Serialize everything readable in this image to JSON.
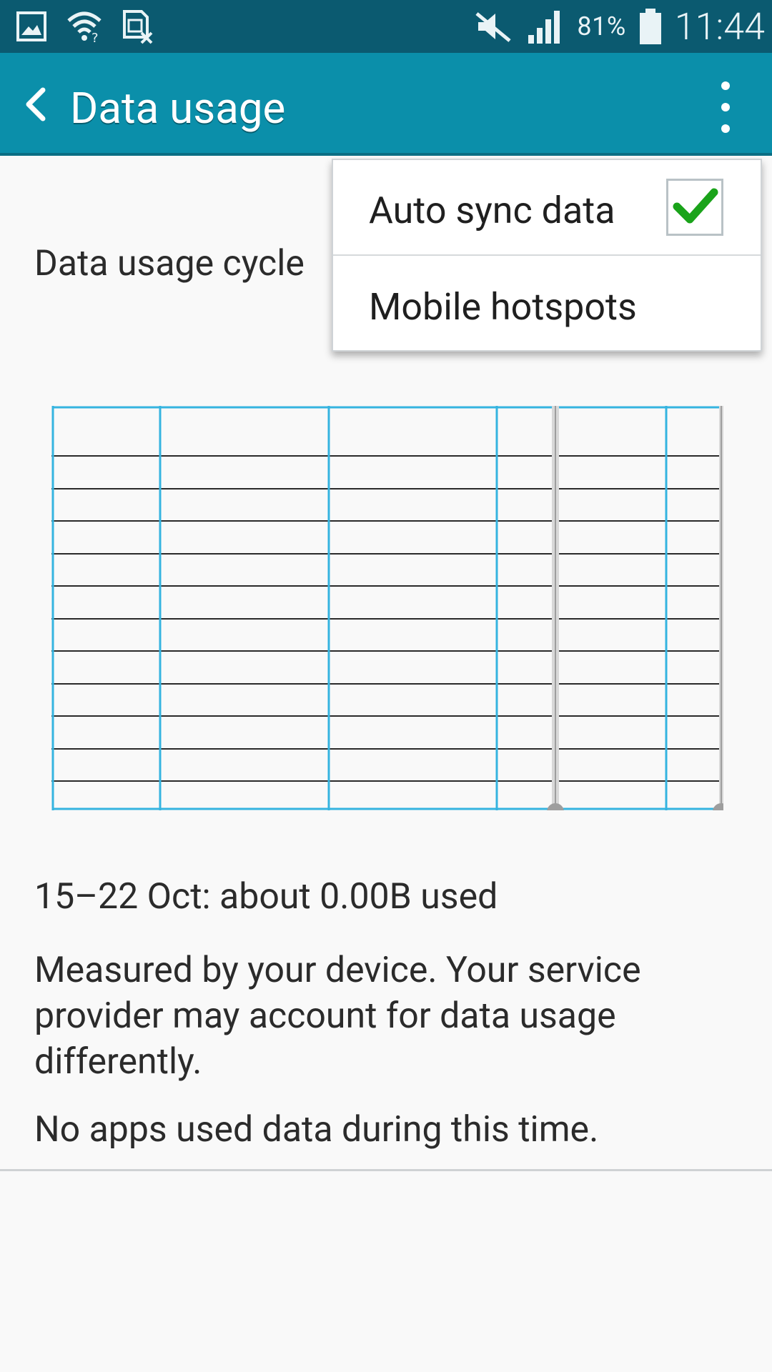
{
  "status_bar": {
    "battery_percent": "81%",
    "time": "11:44",
    "icons": [
      "gallery-icon",
      "wifi-question-icon",
      "no-sim-icon",
      "mute-icon",
      "signal-icon",
      "battery-icon"
    ]
  },
  "app_bar": {
    "title": "Data usage",
    "back_icon": "back-chevron-icon",
    "more_icon": "overflow-menu-icon",
    "background": "#0b8faa"
  },
  "main": {
    "cycle_label": "Data usage cycle",
    "summary": "15–22 Oct: about 0.00B used",
    "note": "Measured by your device. Your service provider may account for data usage differently.",
    "no_apps": "No apps used data during this time."
  },
  "menu": {
    "items": [
      {
        "label": "Auto sync data",
        "checked": true
      },
      {
        "label": "Mobile hotspots"
      }
    ]
  },
  "chart_data": {
    "type": "line",
    "series": [],
    "horizontal_grid_lines": 11,
    "vertical_grid_lines": 6,
    "grid_color": "#35b4e0",
    "handles": [
      "start",
      "end"
    ]
  }
}
